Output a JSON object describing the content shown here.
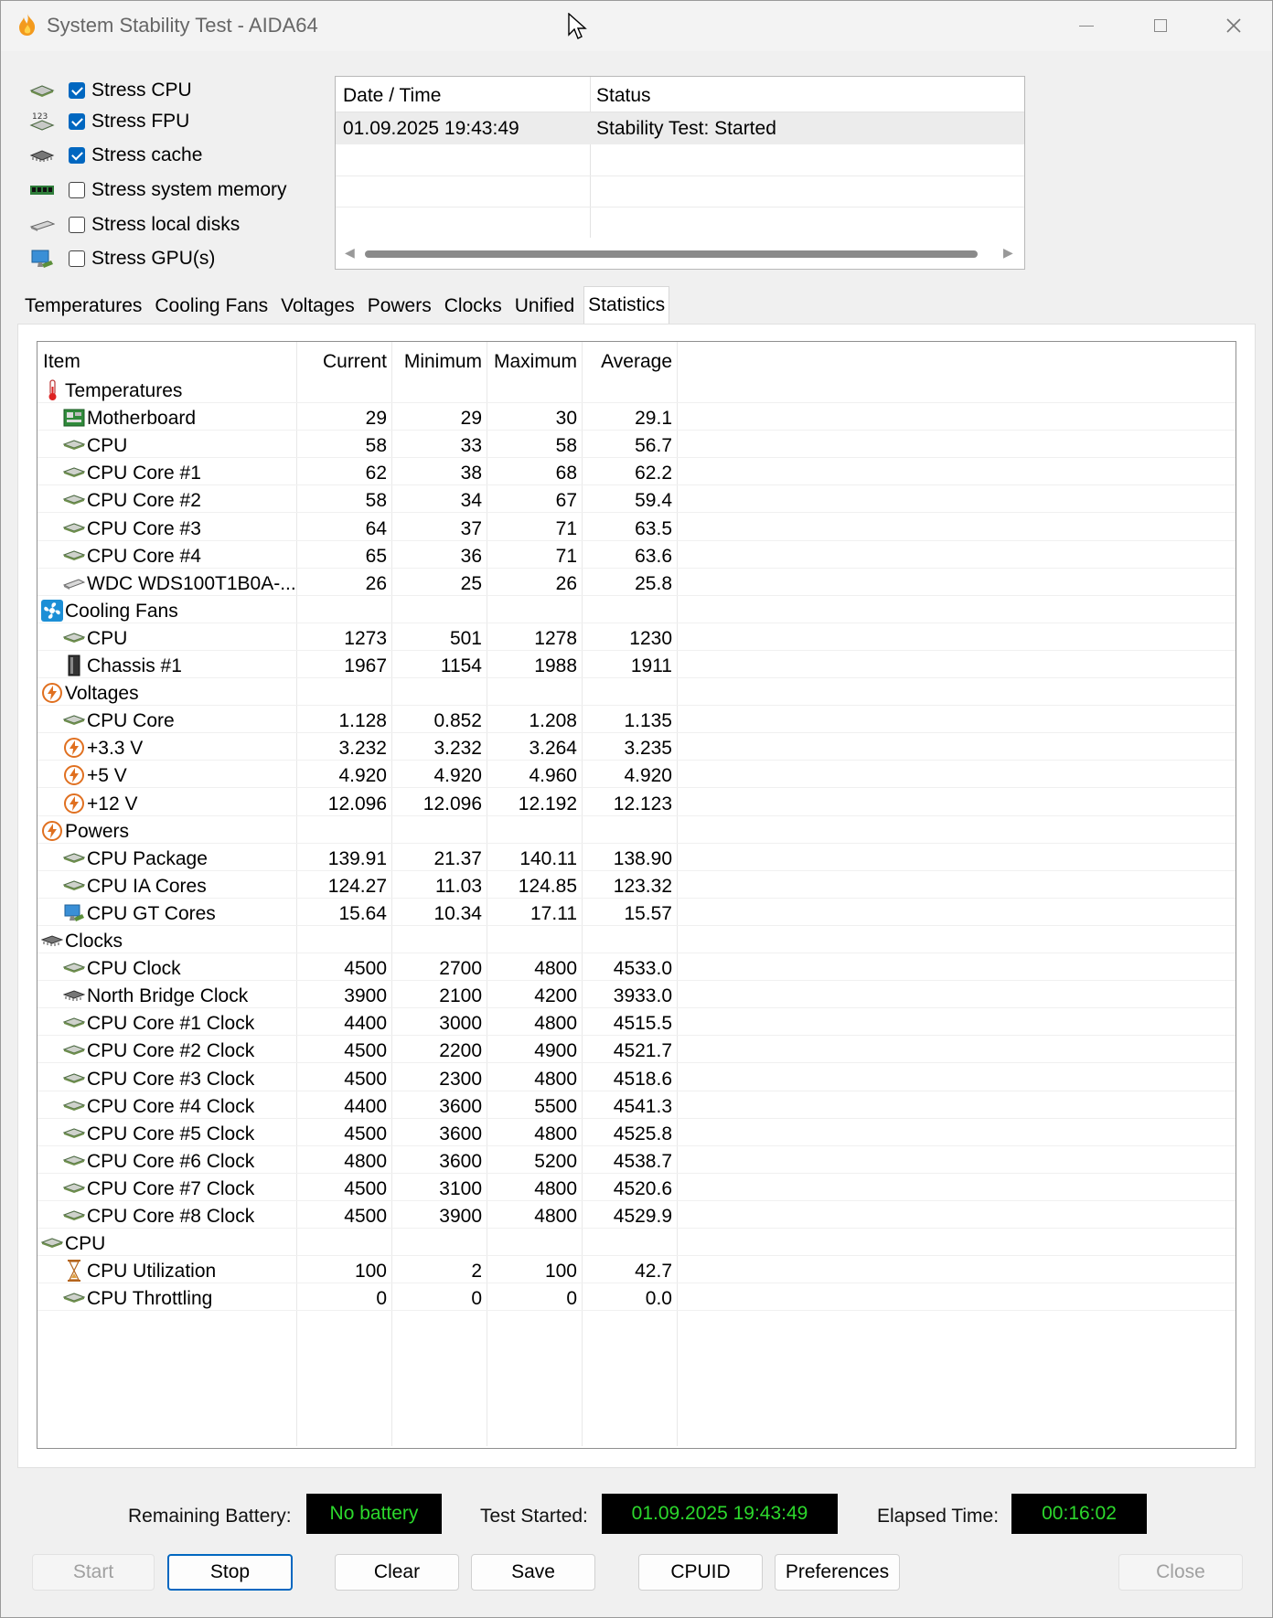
{
  "window": {
    "title": "System Stability Test - AIDA64"
  },
  "stress_options": [
    {
      "label": "Stress CPU",
      "checked": true,
      "icon": "cpu-chip-icon"
    },
    {
      "label": "Stress FPU",
      "checked": true,
      "icon": "fpu-123-icon"
    },
    {
      "label": "Stress cache",
      "checked": true,
      "icon": "cache-chip-icon"
    },
    {
      "label": "Stress system memory",
      "checked": false,
      "icon": "memory-module-icon"
    },
    {
      "label": "Stress local disks",
      "checked": false,
      "icon": "disk-drive-icon"
    },
    {
      "label": "Stress GPU(s)",
      "checked": false,
      "icon": "gpu-monitor-icon"
    }
  ],
  "log": {
    "columns": [
      "Date / Time",
      "Status"
    ],
    "rows": [
      {
        "datetime": "01.09.2025 19:43:49",
        "status": "Stability Test: Started"
      }
    ]
  },
  "tabs": [
    "Temperatures",
    "Cooling Fans",
    "Voltages",
    "Powers",
    "Clocks",
    "Unified",
    "Statistics"
  ],
  "active_tab": "Statistics",
  "statistics": {
    "columns": [
      "Item",
      "Current",
      "Minimum",
      "Maximum",
      "Average"
    ],
    "rows": [
      {
        "group": true,
        "item": "Temperatures",
        "icon": "thermometer-icon"
      },
      {
        "item": "Motherboard",
        "icon": "motherboard-icon",
        "current": "29",
        "minimum": "29",
        "maximum": "30",
        "average": "29.1"
      },
      {
        "item": "CPU",
        "icon": "cpu-chip-icon",
        "current": "58",
        "minimum": "33",
        "maximum": "58",
        "average": "56.7"
      },
      {
        "item": "CPU Core #1",
        "icon": "cpu-chip-icon",
        "current": "62",
        "minimum": "38",
        "maximum": "68",
        "average": "62.2"
      },
      {
        "item": "CPU Core #2",
        "icon": "cpu-chip-icon",
        "current": "58",
        "minimum": "34",
        "maximum": "67",
        "average": "59.4"
      },
      {
        "item": "CPU Core #3",
        "icon": "cpu-chip-icon",
        "current": "64",
        "minimum": "37",
        "maximum": "71",
        "average": "63.5"
      },
      {
        "item": "CPU Core #4",
        "icon": "cpu-chip-icon",
        "current": "65",
        "minimum": "36",
        "maximum": "71",
        "average": "63.6"
      },
      {
        "item": "WDC WDS100T1B0A-...",
        "icon": "disk-drive-icon",
        "current": "26",
        "minimum": "25",
        "maximum": "26",
        "average": "25.8"
      },
      {
        "group": true,
        "item": "Cooling Fans",
        "icon": "fan-icon"
      },
      {
        "item": "CPU",
        "icon": "cpu-chip-icon",
        "current": "1273",
        "minimum": "501",
        "maximum": "1278",
        "average": "1230"
      },
      {
        "item": "Chassis #1",
        "icon": "chassis-icon",
        "current": "1967",
        "minimum": "1154",
        "maximum": "1988",
        "average": "1911"
      },
      {
        "group": true,
        "item": "Voltages",
        "icon": "lightning-icon"
      },
      {
        "item": "CPU Core",
        "icon": "cpu-chip-icon",
        "current": "1.128",
        "minimum": "0.852",
        "maximum": "1.208",
        "average": "1.135"
      },
      {
        "item": "+3.3 V",
        "icon": "lightning-icon",
        "current": "3.232",
        "minimum": "3.232",
        "maximum": "3.264",
        "average": "3.235"
      },
      {
        "item": "+5 V",
        "icon": "lightning-icon",
        "current": "4.920",
        "minimum": "4.920",
        "maximum": "4.960",
        "average": "4.920"
      },
      {
        "item": "+12 V",
        "icon": "lightning-icon",
        "current": "12.096",
        "minimum": "12.096",
        "maximum": "12.192",
        "average": "12.123"
      },
      {
        "group": true,
        "item": "Powers",
        "icon": "lightning-icon"
      },
      {
        "item": "CPU Package",
        "icon": "cpu-chip-icon",
        "current": "139.91",
        "minimum": "21.37",
        "maximum": "140.11",
        "average": "138.90"
      },
      {
        "item": "CPU IA Cores",
        "icon": "cpu-chip-icon",
        "current": "124.27",
        "minimum": "11.03",
        "maximum": "124.85",
        "average": "123.32"
      },
      {
        "item": "CPU GT Cores",
        "icon": "gpu-monitor-icon",
        "current": "15.64",
        "minimum": "10.34",
        "maximum": "17.11",
        "average": "15.57"
      },
      {
        "group": true,
        "item": "Clocks",
        "icon": "clock-chip-icon"
      },
      {
        "item": "CPU Clock",
        "icon": "cpu-chip-icon",
        "current": "4500",
        "minimum": "2700",
        "maximum": "4800",
        "average": "4533.0"
      },
      {
        "item": "North Bridge Clock",
        "icon": "clock-chip-icon",
        "current": "3900",
        "minimum": "2100",
        "maximum": "4200",
        "average": "3933.0"
      },
      {
        "item": "CPU Core #1 Clock",
        "icon": "cpu-chip-icon",
        "current": "4400",
        "minimum": "3000",
        "maximum": "4800",
        "average": "4515.5"
      },
      {
        "item": "CPU Core #2 Clock",
        "icon": "cpu-chip-icon",
        "current": "4500",
        "minimum": "2200",
        "maximum": "4900",
        "average": "4521.7"
      },
      {
        "item": "CPU Core #3 Clock",
        "icon": "cpu-chip-icon",
        "current": "4500",
        "minimum": "2300",
        "maximum": "4800",
        "average": "4518.6"
      },
      {
        "item": "CPU Core #4 Clock",
        "icon": "cpu-chip-icon",
        "current": "4400",
        "minimum": "3600",
        "maximum": "5500",
        "average": "4541.3"
      },
      {
        "item": "CPU Core #5 Clock",
        "icon": "cpu-chip-icon",
        "current": "4500",
        "minimum": "3600",
        "maximum": "4800",
        "average": "4525.8"
      },
      {
        "item": "CPU Core #6 Clock",
        "icon": "cpu-chip-icon",
        "current": "4800",
        "minimum": "3600",
        "maximum": "5200",
        "average": "4538.7"
      },
      {
        "item": "CPU Core #7 Clock",
        "icon": "cpu-chip-icon",
        "current": "4500",
        "minimum": "3100",
        "maximum": "4800",
        "average": "4520.6"
      },
      {
        "item": "CPU Core #8 Clock",
        "icon": "cpu-chip-icon",
        "current": "4500",
        "minimum": "3900",
        "maximum": "4800",
        "average": "4529.9"
      },
      {
        "group": true,
        "item": "CPU",
        "icon": "cpu-chip-icon"
      },
      {
        "item": "CPU Utilization",
        "icon": "hourglass-icon",
        "current": "100",
        "minimum": "2",
        "maximum": "100",
        "average": "42.7"
      },
      {
        "item": "CPU Throttling",
        "icon": "cpu-chip-icon",
        "current": "0",
        "minimum": "0",
        "maximum": "0",
        "average": "0.0"
      }
    ]
  },
  "status_bar": {
    "battery_label": "Remaining Battery:",
    "battery_value": "No battery",
    "started_label": "Test Started:",
    "started_value": "01.09.2025 19:43:49",
    "elapsed_label": "Elapsed Time:",
    "elapsed_value": "00:16:02"
  },
  "buttons": {
    "start": "Start",
    "stop": "Stop",
    "clear": "Clear",
    "save": "Save",
    "cpuid": "CPUID",
    "preferences": "Preferences",
    "close": "Close"
  },
  "colors": {
    "lcd_background": "#000000",
    "lcd_text": "#2cd82c",
    "checkbox_accent": "#0067c0"
  }
}
